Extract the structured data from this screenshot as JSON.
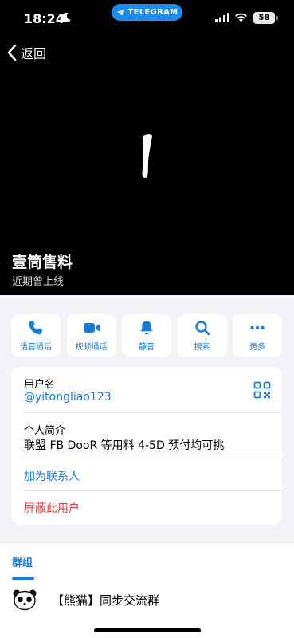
{
  "status_bar": {
    "time": "18:24",
    "pill_label": "TELEGRAM",
    "battery": "58"
  },
  "nav": {
    "back_label": "返回"
  },
  "profile": {
    "name": "壹筒售料",
    "status": "近期曾上线"
  },
  "actions": [
    {
      "label": "语音通话",
      "icon": "phone-icon"
    },
    {
      "label": "视频通话",
      "icon": "video-icon"
    },
    {
      "label": "静音",
      "icon": "bell-icon"
    },
    {
      "label": "搜索",
      "icon": "search-icon"
    },
    {
      "label": "更多",
      "icon": "more-icon"
    }
  ],
  "info": {
    "username_label": "用户名",
    "username_value": "@yitongliao123",
    "bio_label": "个人简介",
    "bio_value": "联盟 FB DooR 等用料 4-5D 预付均可挑",
    "add_contact": "加为联系人",
    "block_user": "屏蔽此用户"
  },
  "groups": {
    "tab_label": "群组",
    "items": [
      {
        "name": "【熊猫】同步交流群",
        "avatar_text": "PANDA"
      }
    ]
  },
  "colors": {
    "accent": "#1a7bd6",
    "danger": "#e0403a",
    "pill": "#1d8cf1",
    "header_bg": "#000000",
    "page_bg": "#f2f2f7"
  }
}
